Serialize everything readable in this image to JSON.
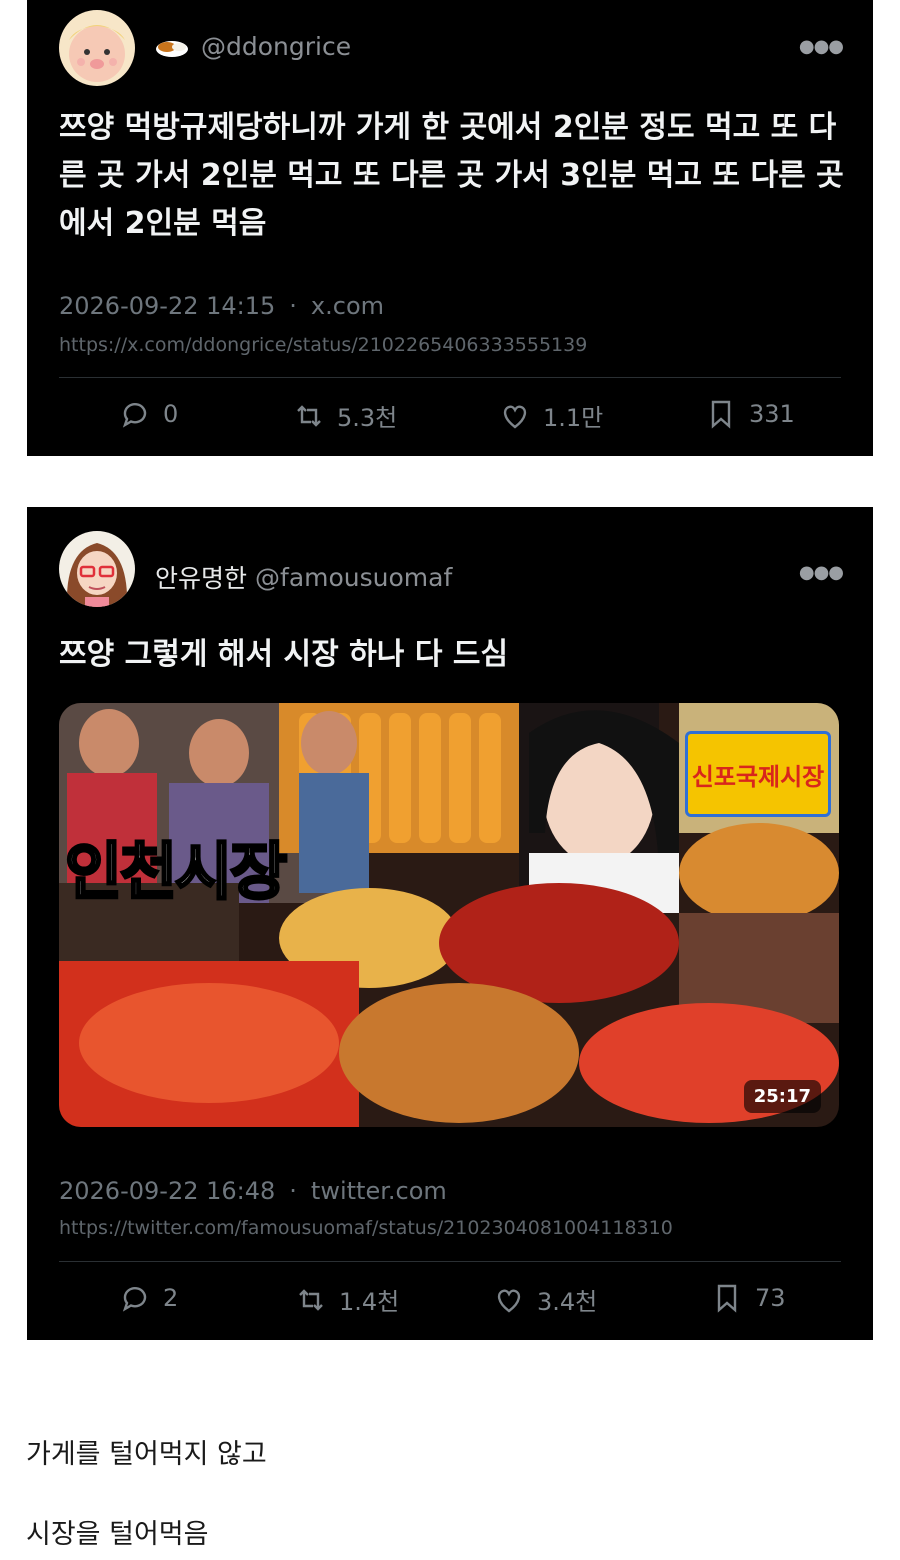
{
  "tweets": [
    {
      "display_name": "",
      "handle": "@ddongrice",
      "text": "쯔양 먹방규제당하니까 가게 한 곳에서 2인분 정도 먹고 또 다른 곳 가서 2인분 먹고 또 다른 곳 가서 3인분 먹고 또 다른 곳에서 2인분 먹음",
      "timestamp": "2026-09-22 14:15",
      "dot": "·",
      "source": "x.com",
      "url": "https://x.com/ddongrice/status/2102265406333555139",
      "replies": "0",
      "retweets": "5.3천",
      "likes": "1.1만",
      "bookmarks": "331"
    },
    {
      "display_name": "안유명한",
      "handle": "@famousuomaf",
      "text": "쯔양 그렇게 해서 시장 하나 다 드심",
      "timestamp": "2026-09-22 16:48",
      "dot": "·",
      "source": "twitter.com",
      "url": "https://twitter.com/famousuomaf/status/2102304081004118310",
      "replies": "2",
      "retweets": "1.4천",
      "likes": "3.4천",
      "bookmarks": "73",
      "media": {
        "thumbnail_title": "인천시장",
        "sign_text": "신포국제시장",
        "duration": "25:17"
      }
    }
  ],
  "captions": [
    "가게를 털어먹지 않고",
    "시장을 털어먹음"
  ],
  "colors": {
    "card_bg": "#000000",
    "muted": "#6e767d",
    "text": "#e7e9ea"
  }
}
